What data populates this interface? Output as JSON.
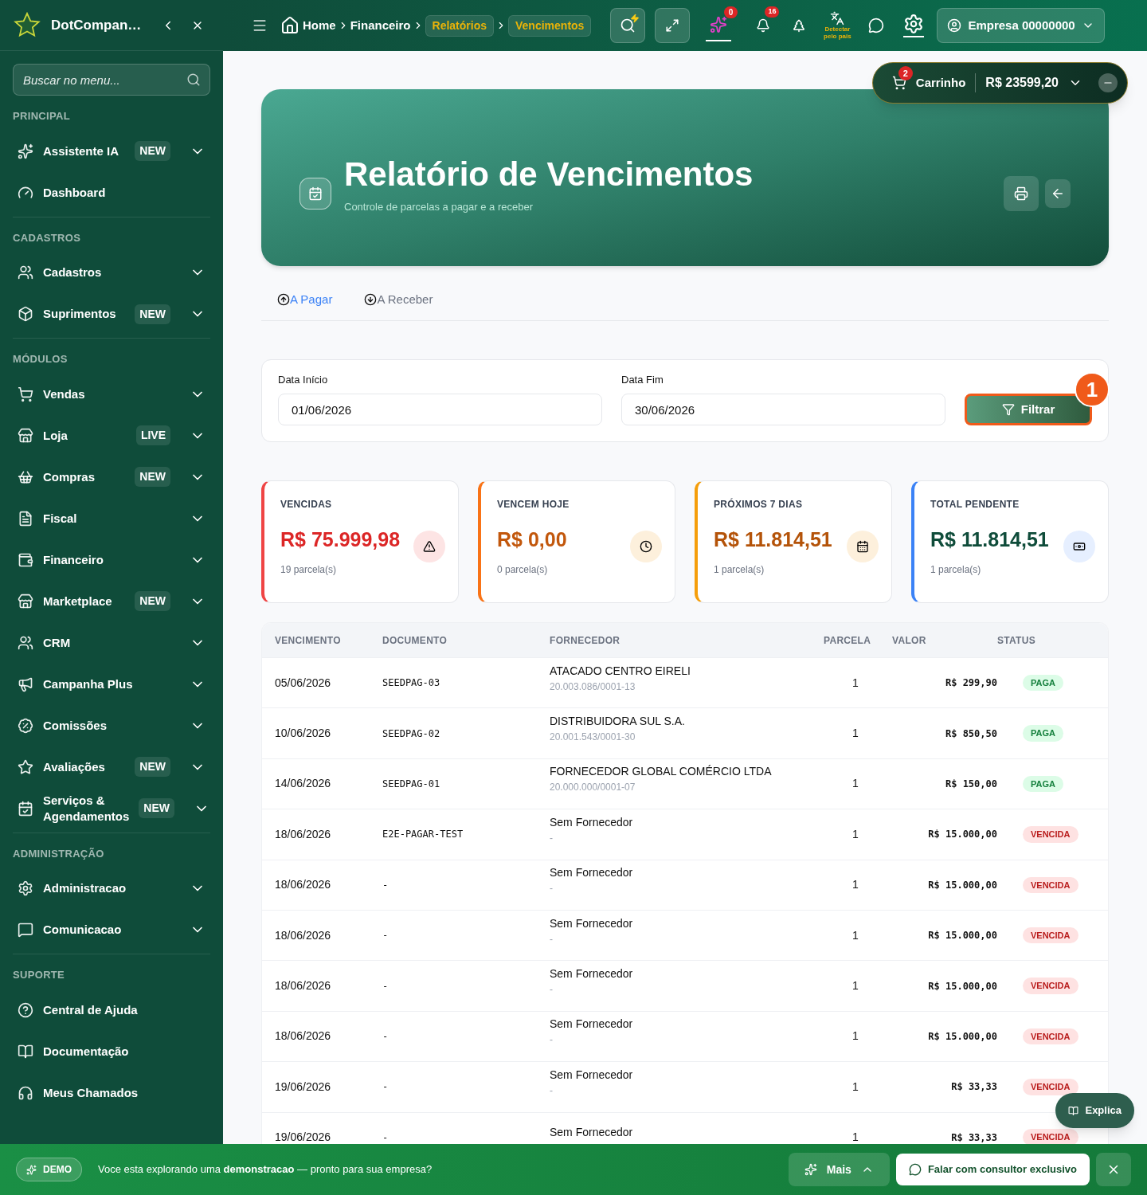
{
  "brand": {
    "name": "DotCompan…"
  },
  "sidebar": {
    "search_placeholder": "Buscar no menu...",
    "sections": [
      {
        "title": "PRINCIPAL",
        "items": [
          {
            "label": "Assistente IA",
            "badge": "NEW",
            "expandable": true
          },
          {
            "label": "Dashboard",
            "expandable": false
          }
        ]
      },
      {
        "title": "CADASTROS",
        "items": [
          {
            "label": "Cadastros",
            "expandable": true
          },
          {
            "label": "Suprimentos",
            "badge": "NEW",
            "expandable": true
          }
        ]
      },
      {
        "title": "MÓDULOS",
        "items": [
          {
            "label": "Vendas",
            "expandable": true
          },
          {
            "label": "Loja",
            "badge": "LIVE",
            "expandable": true
          },
          {
            "label": "Compras",
            "badge": "NEW",
            "expandable": true
          },
          {
            "label": "Fiscal",
            "expandable": true
          },
          {
            "label": "Financeiro",
            "expandable": true
          },
          {
            "label": "Marketplace",
            "badge": "NEW",
            "expandable": true
          },
          {
            "label": "CRM",
            "expandable": true
          },
          {
            "label": "Campanha Plus",
            "expandable": true
          },
          {
            "label": "Comissões",
            "expandable": true
          },
          {
            "label": "Avaliações",
            "badge": "NEW",
            "expandable": true
          },
          {
            "label": "Serviços & Agendamentos",
            "badge": "NEW",
            "expandable": true
          }
        ]
      },
      {
        "title": "ADMINISTRAÇÃO",
        "items": [
          {
            "label": "Administracao",
            "expandable": true
          },
          {
            "label": "Comunicacao",
            "expandable": true
          }
        ]
      },
      {
        "title": "SUPORTE",
        "items": [
          {
            "label": "Central de Ajuda",
            "expandable": false
          },
          {
            "label": "Documentação",
            "expandable": false
          },
          {
            "label": "Meus Chamados",
            "expandable": false
          }
        ]
      }
    ]
  },
  "breadcrumb": [
    {
      "label": "Home",
      "kind": "link"
    },
    {
      "label": "Financeiro",
      "kind": "link"
    },
    {
      "label": "Relatórios",
      "kind": "chip"
    },
    {
      "label": "Vencimentos",
      "kind": "chip"
    }
  ],
  "topbar": {
    "ai_count": "0",
    "notification_count": "16",
    "language_label": "Detectar pelo pais",
    "account": "Empresa 00000000"
  },
  "cart": {
    "count": "2",
    "label": "Carrinho",
    "total": "R$ 23599,20"
  },
  "hero": {
    "title": "Relatório de Vencimentos",
    "subtitle": "Controle de parcelas a pagar e a receber"
  },
  "tabs": [
    {
      "label": "A Pagar",
      "selected": true
    },
    {
      "label": "A Receber",
      "selected": false
    }
  ],
  "filter": {
    "start_label": "Data Início",
    "start_value": "01/06/2026",
    "end_label": "Data Fim",
    "end_value": "30/06/2026",
    "button": "Filtrar",
    "step": "1"
  },
  "stats": [
    {
      "label": "VENCIDAS",
      "value": "R$ 75.999,98",
      "sub": "19 parcela(s)",
      "color": "#ef4444"
    },
    {
      "label": "VENCEM HOJE",
      "value": "R$ 0,00",
      "sub": "0 parcela(s)",
      "color": "#f97316"
    },
    {
      "label": "PRÓXIMOS 7 DIAS",
      "value": "R$ 11.814,51",
      "sub": "1 parcela(s)",
      "color": "#f59e0b"
    },
    {
      "label": "TOTAL PENDENTE",
      "value": "R$ 11.814,51",
      "sub": "1 parcela(s)",
      "color": "#3b82f6"
    }
  ],
  "table": {
    "columns": [
      "VENCIMENTO",
      "DOCUMENTO",
      "FORNECEDOR",
      "PARCELA",
      "VALOR",
      "STATUS"
    ],
    "rows": [
      {
        "due": "05/06/2026",
        "document": "SEEDPAG-03",
        "supplier": "ATACADO CENTRO EIRELI",
        "tax_id": "20.003.086/0001-13",
        "installment": "1",
        "amount": "R$ 299,90",
        "status": "PAGA",
        "kind": "paid"
      },
      {
        "due": "10/06/2026",
        "document": "SEEDPAG-02",
        "supplier": "DISTRIBUIDORA SUL S.A.",
        "tax_id": "20.001.543/0001-30",
        "installment": "1",
        "amount": "R$ 850,50",
        "status": "PAGA",
        "kind": "paid"
      },
      {
        "due": "14/06/2026",
        "document": "SEEDPAG-01",
        "supplier": "FORNECEDOR GLOBAL COMÉRCIO LTDA",
        "tax_id": "20.000.000/0001-07",
        "installment": "1",
        "amount": "R$ 150,00",
        "status": "PAGA",
        "kind": "paid"
      },
      {
        "due": "18/06/2026",
        "document": "E2E-PAGAR-TEST",
        "supplier": "Sem Fornecedor",
        "tax_id": "-",
        "installment": "1",
        "amount": "R$ 15.000,00",
        "status": "VENCIDA",
        "kind": "overdue"
      },
      {
        "due": "18/06/2026",
        "document": "-",
        "supplier": "Sem Fornecedor",
        "tax_id": "-",
        "installment": "1",
        "amount": "R$ 15.000,00",
        "status": "VENCIDA",
        "kind": "overdue"
      },
      {
        "due": "18/06/2026",
        "document": "-",
        "supplier": "Sem Fornecedor",
        "tax_id": "-",
        "installment": "1",
        "amount": "R$ 15.000,00",
        "status": "VENCIDA",
        "kind": "overdue"
      },
      {
        "due": "18/06/2026",
        "document": "-",
        "supplier": "Sem Fornecedor",
        "tax_id": "-",
        "installment": "1",
        "amount": "R$ 15.000,00",
        "status": "VENCIDA",
        "kind": "overdue"
      },
      {
        "due": "18/06/2026",
        "document": "-",
        "supplier": "Sem Fornecedor",
        "tax_id": "-",
        "installment": "1",
        "amount": "R$ 15.000,00",
        "status": "VENCIDA",
        "kind": "overdue"
      },
      {
        "due": "19/06/2026",
        "document": "-",
        "supplier": "Sem Fornecedor",
        "tax_id": "-",
        "installment": "1",
        "amount": "R$ 33,33",
        "status": "VENCIDA",
        "kind": "overdue"
      },
      {
        "due": "19/06/2026",
        "document": "-",
        "supplier": "Sem Fornecedor",
        "installment": "1",
        "amount": "R$ 33,33",
        "status": "VENCIDA",
        "kind": "overdue"
      }
    ]
  },
  "explain_button": "Explica",
  "demo_bar": {
    "badge": "DEMO",
    "message": "Voce esta explorando uma **demonstracao** — pronto para sua empresa?",
    "more": "Mais",
    "cta": "Falar com consultor exclusivo"
  }
}
